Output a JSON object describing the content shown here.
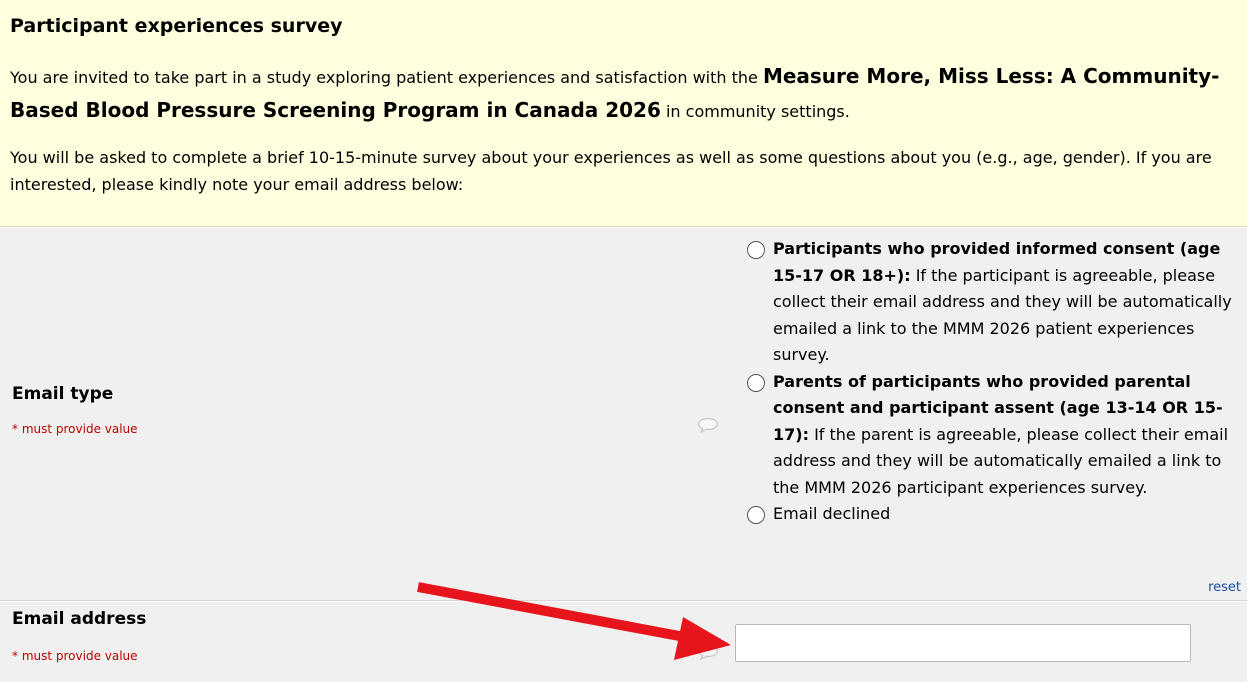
{
  "survey": {
    "title": "Participant experiences survey",
    "intro_prefix": "You are invited to take part in a study exploring patient experiences and satisfaction with the ",
    "intro_program": "Measure More, Miss Less: A Community-Based Blood Pressure Screening Program in Canada 2026",
    "intro_suffix": " in community settings.",
    "details": "You will be asked to complete a brief 10-15-minute survey about your experiences as well as some questions about you (e.g., age, gender). If you are interested, please kindly note your email address below:"
  },
  "email_type": {
    "label": "Email type",
    "required_note": "* must provide value",
    "options": [
      {
        "bold": "Participants who provided informed consent (age 15-17 OR 18+):",
        "text": " If the participant is agreeable, please collect their email address and they will be automatically emailed a link to the MMM 2026 patient experiences survey.",
        "selected": false
      },
      {
        "bold": "Parents of participants who provided parental consent and participant assent (age 13-14 OR 15-17):",
        "text": " If the parent is agreeable, please collect their email address and they will be automatically emailed a link to the MMM 2026 participant experiences survey.",
        "selected": false
      },
      {
        "bold": "",
        "text": "Email declined",
        "selected": false
      }
    ],
    "reset_label": "reset"
  },
  "email_address": {
    "label": "Email address",
    "required_note": "* must provide value",
    "value": ""
  },
  "icons": {
    "comment": "comment-bubble-icon",
    "annotation": "red-arrow"
  },
  "colors": {
    "header_bg": "#ffffe0",
    "row_bg": "#f0f0f0",
    "required": "#c00000",
    "link": "#1c4c9c",
    "arrow": "#e8141c"
  }
}
